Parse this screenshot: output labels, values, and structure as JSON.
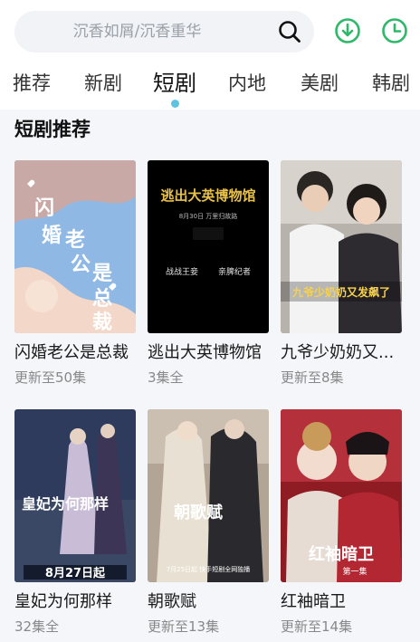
{
  "search": {
    "placeholder": "沉香如屑/沉香重华"
  },
  "icons": {
    "search": "search-icon",
    "download": "download-icon",
    "history": "clock-icon"
  },
  "colors": {
    "accent": "#2fb86a",
    "tab_indicator": "#5fc3e0",
    "section_bg": "#f4f6fa"
  },
  "tabs": [
    {
      "label": "推荐"
    },
    {
      "label": "新剧"
    },
    {
      "label": "短剧",
      "active": true
    },
    {
      "label": "内地"
    },
    {
      "label": "美剧"
    },
    {
      "label": "韩剧"
    }
  ],
  "section": {
    "title": "短剧推荐"
  },
  "cards": [
    {
      "title": "闪婚老公是总裁",
      "status": "更新至50集",
      "poster_text": [
        "闪",
        "婚",
        "老",
        "公",
        "是",
        "总",
        "裁"
      ]
    },
    {
      "title": "逃出大英博物馆",
      "status": "3集全",
      "poster_text": [
        "逃出大英博物馆",
        "8月30日 万里归故路",
        "战战王妾",
        "亲脾纪者"
      ]
    },
    {
      "title": "九爷少奶奶又...",
      "status": "更新至8集",
      "poster_text": [
        "九爷少奶奶又发飙了"
      ]
    },
    {
      "title": "皇妃为何那样",
      "status": "32集全",
      "poster_text": [
        "皇妃为何那样",
        "8月27日起"
      ]
    },
    {
      "title": "朝歌赋",
      "status": "更新至13集",
      "poster_text": [
        "朝歌赋",
        "7月25日起 快手短剧全网独播"
      ]
    },
    {
      "title": "红袖暗卫",
      "status": "更新至14集",
      "poster_text": [
        "红袖暗卫",
        "第一集"
      ]
    }
  ]
}
